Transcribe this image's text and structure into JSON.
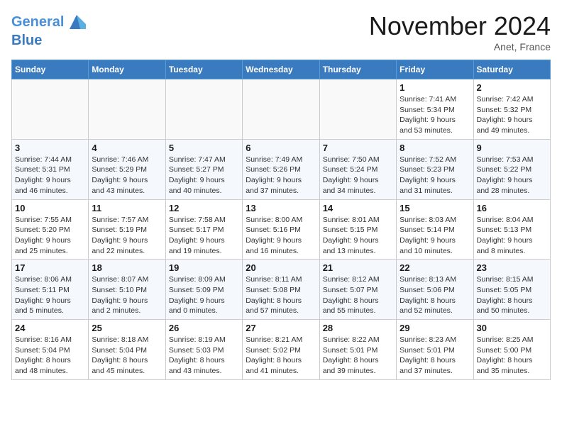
{
  "header": {
    "logo_line1": "General",
    "logo_line2": "Blue",
    "month_title": "November 2024",
    "location": "Anet, France"
  },
  "weekdays": [
    "Sunday",
    "Monday",
    "Tuesday",
    "Wednesday",
    "Thursday",
    "Friday",
    "Saturday"
  ],
  "weeks": [
    [
      {
        "day": "",
        "info": ""
      },
      {
        "day": "",
        "info": ""
      },
      {
        "day": "",
        "info": ""
      },
      {
        "day": "",
        "info": ""
      },
      {
        "day": "",
        "info": ""
      },
      {
        "day": "1",
        "info": "Sunrise: 7:41 AM\nSunset: 5:34 PM\nDaylight: 9 hours\nand 53 minutes."
      },
      {
        "day": "2",
        "info": "Sunrise: 7:42 AM\nSunset: 5:32 PM\nDaylight: 9 hours\nand 49 minutes."
      }
    ],
    [
      {
        "day": "3",
        "info": "Sunrise: 7:44 AM\nSunset: 5:31 PM\nDaylight: 9 hours\nand 46 minutes."
      },
      {
        "day": "4",
        "info": "Sunrise: 7:46 AM\nSunset: 5:29 PM\nDaylight: 9 hours\nand 43 minutes."
      },
      {
        "day": "5",
        "info": "Sunrise: 7:47 AM\nSunset: 5:27 PM\nDaylight: 9 hours\nand 40 minutes."
      },
      {
        "day": "6",
        "info": "Sunrise: 7:49 AM\nSunset: 5:26 PM\nDaylight: 9 hours\nand 37 minutes."
      },
      {
        "day": "7",
        "info": "Sunrise: 7:50 AM\nSunset: 5:24 PM\nDaylight: 9 hours\nand 34 minutes."
      },
      {
        "day": "8",
        "info": "Sunrise: 7:52 AM\nSunset: 5:23 PM\nDaylight: 9 hours\nand 31 minutes."
      },
      {
        "day": "9",
        "info": "Sunrise: 7:53 AM\nSunset: 5:22 PM\nDaylight: 9 hours\nand 28 minutes."
      }
    ],
    [
      {
        "day": "10",
        "info": "Sunrise: 7:55 AM\nSunset: 5:20 PM\nDaylight: 9 hours\nand 25 minutes."
      },
      {
        "day": "11",
        "info": "Sunrise: 7:57 AM\nSunset: 5:19 PM\nDaylight: 9 hours\nand 22 minutes."
      },
      {
        "day": "12",
        "info": "Sunrise: 7:58 AM\nSunset: 5:17 PM\nDaylight: 9 hours\nand 19 minutes."
      },
      {
        "day": "13",
        "info": "Sunrise: 8:00 AM\nSunset: 5:16 PM\nDaylight: 9 hours\nand 16 minutes."
      },
      {
        "day": "14",
        "info": "Sunrise: 8:01 AM\nSunset: 5:15 PM\nDaylight: 9 hours\nand 13 minutes."
      },
      {
        "day": "15",
        "info": "Sunrise: 8:03 AM\nSunset: 5:14 PM\nDaylight: 9 hours\nand 10 minutes."
      },
      {
        "day": "16",
        "info": "Sunrise: 8:04 AM\nSunset: 5:13 PM\nDaylight: 9 hours\nand 8 minutes."
      }
    ],
    [
      {
        "day": "17",
        "info": "Sunrise: 8:06 AM\nSunset: 5:11 PM\nDaylight: 9 hours\nand 5 minutes."
      },
      {
        "day": "18",
        "info": "Sunrise: 8:07 AM\nSunset: 5:10 PM\nDaylight: 9 hours\nand 2 minutes."
      },
      {
        "day": "19",
        "info": "Sunrise: 8:09 AM\nSunset: 5:09 PM\nDaylight: 9 hours\nand 0 minutes."
      },
      {
        "day": "20",
        "info": "Sunrise: 8:11 AM\nSunset: 5:08 PM\nDaylight: 8 hours\nand 57 minutes."
      },
      {
        "day": "21",
        "info": "Sunrise: 8:12 AM\nSunset: 5:07 PM\nDaylight: 8 hours\nand 55 minutes."
      },
      {
        "day": "22",
        "info": "Sunrise: 8:13 AM\nSunset: 5:06 PM\nDaylight: 8 hours\nand 52 minutes."
      },
      {
        "day": "23",
        "info": "Sunrise: 8:15 AM\nSunset: 5:05 PM\nDaylight: 8 hours\nand 50 minutes."
      }
    ],
    [
      {
        "day": "24",
        "info": "Sunrise: 8:16 AM\nSunset: 5:04 PM\nDaylight: 8 hours\nand 48 minutes."
      },
      {
        "day": "25",
        "info": "Sunrise: 8:18 AM\nSunset: 5:04 PM\nDaylight: 8 hours\nand 45 minutes."
      },
      {
        "day": "26",
        "info": "Sunrise: 8:19 AM\nSunset: 5:03 PM\nDaylight: 8 hours\nand 43 minutes."
      },
      {
        "day": "27",
        "info": "Sunrise: 8:21 AM\nSunset: 5:02 PM\nDaylight: 8 hours\nand 41 minutes."
      },
      {
        "day": "28",
        "info": "Sunrise: 8:22 AM\nSunset: 5:01 PM\nDaylight: 8 hours\nand 39 minutes."
      },
      {
        "day": "29",
        "info": "Sunrise: 8:23 AM\nSunset: 5:01 PM\nDaylight: 8 hours\nand 37 minutes."
      },
      {
        "day": "30",
        "info": "Sunrise: 8:25 AM\nSunset: 5:00 PM\nDaylight: 8 hours\nand 35 minutes."
      }
    ]
  ]
}
